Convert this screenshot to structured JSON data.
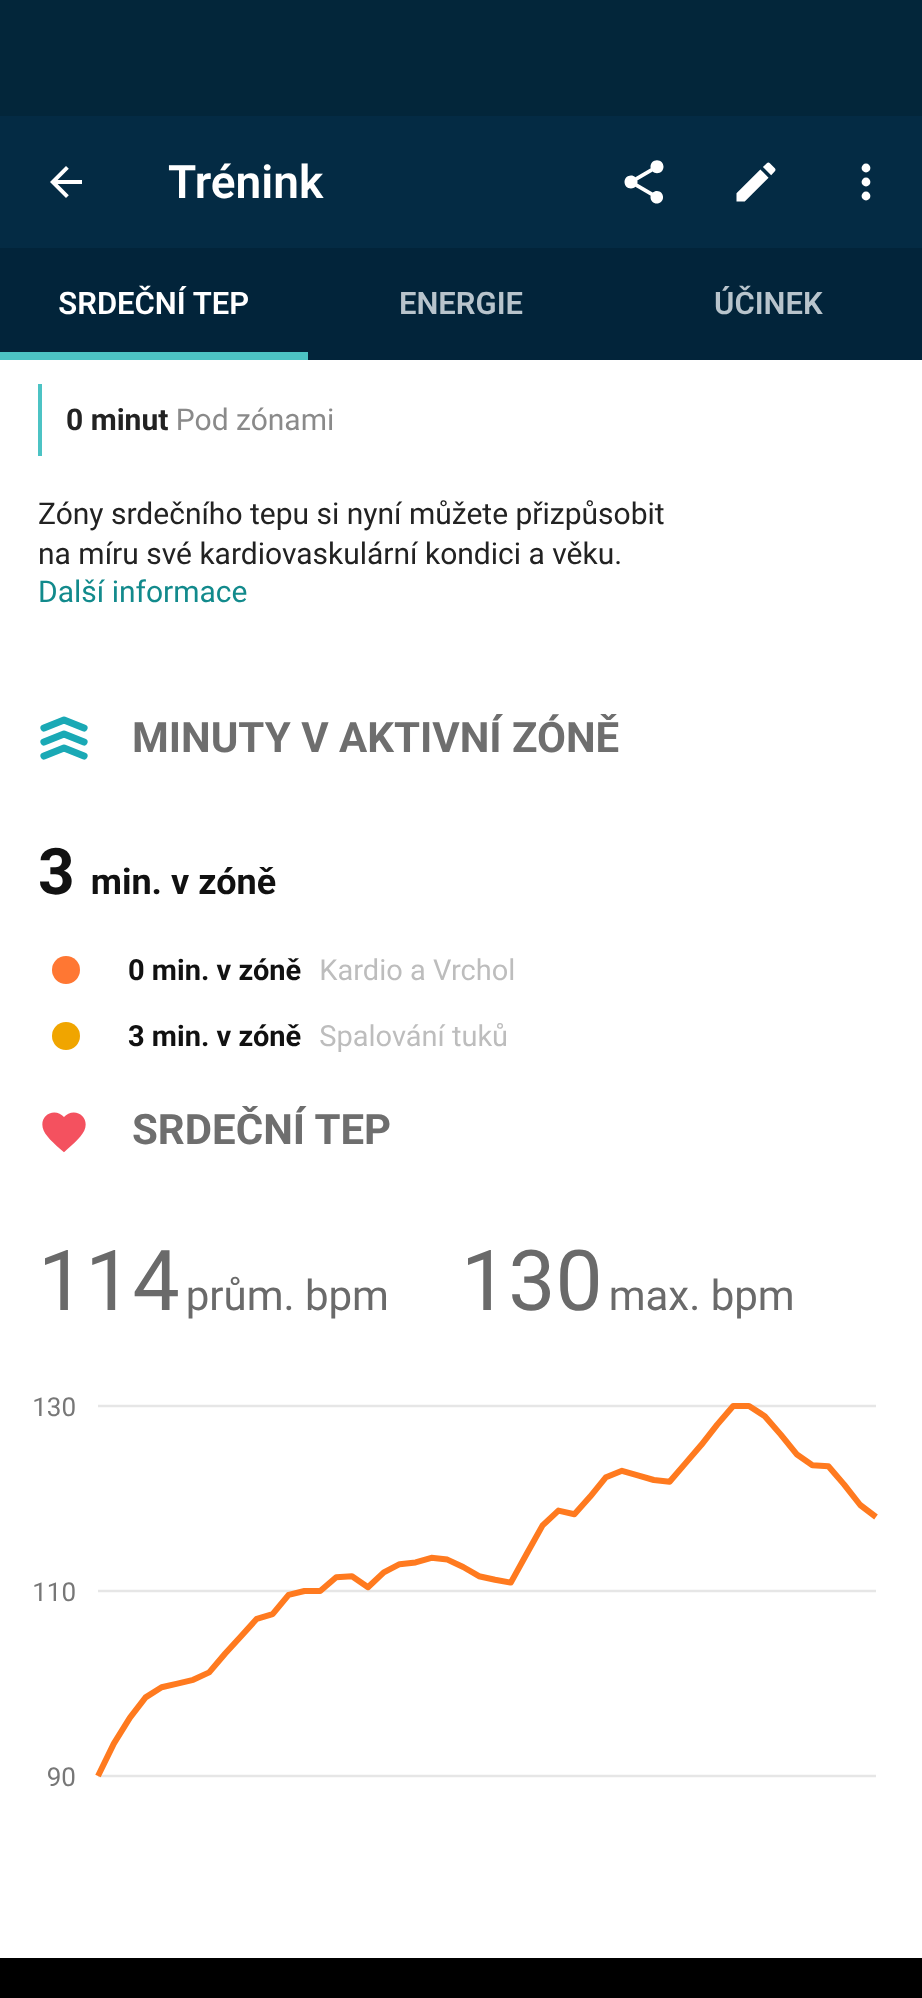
{
  "app_bar": {
    "title": "Trénink"
  },
  "tabs": [
    {
      "label": "SRDEČNÍ TEP",
      "selected": true
    },
    {
      "label": "ENERGIE",
      "selected": false
    },
    {
      "label": "ÚČINEK",
      "selected": false
    }
  ],
  "below_zones": {
    "minutes": "0 minut",
    "label": "Pod zónami"
  },
  "info": {
    "text": "Zóny srdečního tepu si nyní můžete přizpůsobit na míru své kardiovaskulární kondici a věku.",
    "link": "Další informace"
  },
  "active_zone": {
    "title": "MINUTY V AKTIVNÍ ZÓNĚ",
    "total_number": "3",
    "total_unit": "min. v zóně",
    "zones": [
      {
        "minutes": "0 min. v zóně",
        "name": "Kardio a Vrchol",
        "color": "#ff7733"
      },
      {
        "minutes": "3 min. v zóně",
        "name": "Spalování tuků",
        "color": "#f0a500"
      }
    ]
  },
  "heart_rate": {
    "title": "SRDEČNÍ TEP",
    "average": {
      "value": "114",
      "unit": "prům. bpm"
    },
    "maximum": {
      "value": "130",
      "unit": "max. bpm"
    },
    "chart_data": {
      "type": "line",
      "ylim": [
        90,
        130
      ],
      "yticks": [
        90,
        110,
        130
      ],
      "series": [
        {
          "color": "#ff7a1f",
          "values": [
            90,
            93.5,
            96.3,
            98.5,
            99.6,
            100,
            100.4,
            101.2,
            103.2,
            105.1,
            107,
            107.5,
            109.6,
            110,
            110,
            111.5,
            111.6,
            110.4,
            112,
            112.9,
            113.1,
            113.6,
            113.4,
            112.6,
            111.6,
            111.2,
            110.9,
            114,
            117.1,
            118.7,
            118.3,
            120.2,
            122.3,
            123,
            122.5,
            122,
            121.8,
            123.8,
            125.8,
            128,
            130,
            130,
            128.9,
            126.9,
            124.8,
            123.6,
            123.5,
            121.5,
            119.3,
            118
          ]
        }
      ]
    }
  }
}
